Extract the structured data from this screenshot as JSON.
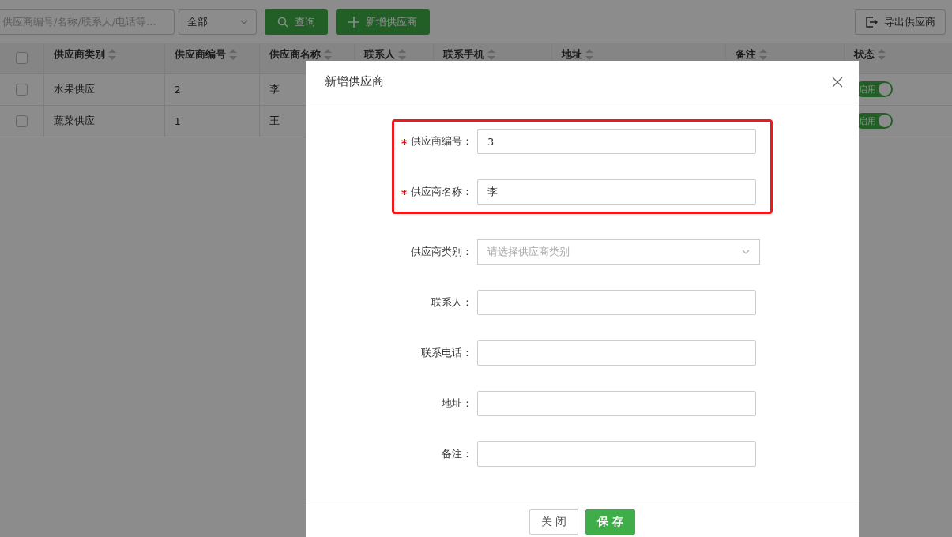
{
  "toolbar": {
    "search": {
      "placeholder": "供应商编号/名称/联系人/电话等..."
    },
    "filter": {
      "value": "全部"
    },
    "query_button": "查询",
    "add_button": "新增供应商",
    "export_button": "导出供应商"
  },
  "table": {
    "all_checked": false,
    "columns": [
      {
        "label": "供应商类别"
      },
      {
        "label": "供应商编号"
      },
      {
        "label": "供应商名称"
      },
      {
        "label": "联系人"
      },
      {
        "label": "联系手机"
      },
      {
        "label": "地址"
      },
      {
        "label": "备注"
      },
      {
        "label": "状态"
      }
    ],
    "rows": [
      {
        "checked": false,
        "category": "水果供应",
        "code": "2",
        "name": "李",
        "status": {
          "label": "启用",
          "on": true
        }
      },
      {
        "checked": false,
        "category": "蔬菜供应",
        "code": "1",
        "name": "王",
        "status": {
          "label": "启用",
          "on": true
        }
      }
    ]
  },
  "dialog": {
    "title": "新增供应商",
    "sections": [
      {
        "highlighted": true,
        "fields": [
          {
            "kind": "text",
            "label": "供应商编号：",
            "required": true,
            "value": "3"
          },
          {
            "kind": "text",
            "label": "供应商名称：",
            "required": true,
            "value": "李"
          }
        ]
      },
      {
        "highlighted": false,
        "fields": [
          {
            "kind": "select",
            "label": "供应商类别：",
            "required": false,
            "placeholder": "请选择供应商类别"
          },
          {
            "kind": "text",
            "label": "联系人：",
            "required": false
          },
          {
            "kind": "text",
            "label": "联系电话：",
            "required": false
          },
          {
            "kind": "text",
            "label": "地址：",
            "required": false
          },
          {
            "kind": "text",
            "label": "备注：",
            "required": false
          }
        ]
      }
    ],
    "buttons": [
      {
        "label": "关 闭",
        "kind": "secondary"
      },
      {
        "label": "保 存",
        "kind": "primary"
      }
    ]
  }
}
